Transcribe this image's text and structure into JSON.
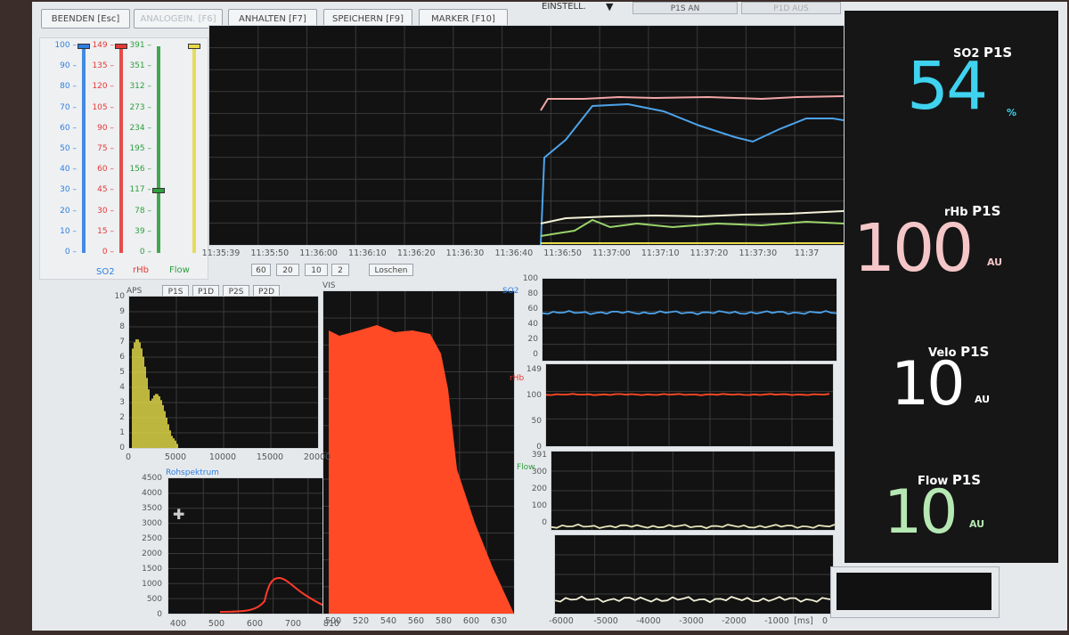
{
  "toolbar": {
    "beenden": "BEENDEN [Esc]",
    "analog": "ANALOGEIN. [F6]",
    "anhalten": "ANHALTEN [F7]",
    "speichern": "SPEICHERN [F9]",
    "marker": "MARKER [F10]",
    "einstell": "EINSTELL."
  },
  "tabs": {
    "p1s_an": "P1S AN",
    "p1d": "P1D AUS"
  },
  "sliders": {
    "so2": {
      "label": "SO2",
      "color": "#2f7fe0",
      "ticks": [
        "100",
        "90",
        "80",
        "70",
        "60",
        "50",
        "40",
        "30",
        "20",
        "10",
        "0"
      ],
      "value": 100
    },
    "rhb": {
      "label": "rHb",
      "color": "#e53935",
      "ticks": [
        "149",
        "135",
        "120",
        "105",
        "90",
        "75",
        "60",
        "45",
        "30",
        "15",
        "0"
      ],
      "value": 149
    },
    "flow": {
      "label": "Flow",
      "color": "#2e9e3e",
      "ticks": [
        "391",
        "351",
        "312",
        "273",
        "234",
        "195",
        "156",
        "117",
        "78",
        "39",
        "0"
      ],
      "value": 30
    },
    "velo": {
      "label": "",
      "color": "#e6d84a",
      "value": 100
    }
  },
  "trend": {
    "times": [
      "11:35:39",
      "11:35:50",
      "11:36:00",
      "11:36:10",
      "11:36:20",
      "11:36:30",
      "11:36:40",
      "11:36:50",
      "11:37:00",
      "11:37:10",
      "11:37:20",
      "11:37:30",
      "11:37"
    ],
    "zoom": [
      "60",
      "20",
      "10",
      "2"
    ],
    "loschen": "Loschen"
  },
  "aps": {
    "label": "APS",
    "buttons": [
      "P1S",
      "P1D",
      "P2S",
      "P2D"
    ],
    "yticks": [
      "10",
      "9",
      "8",
      "7",
      "6",
      "5",
      "4",
      "3",
      "2",
      "1",
      "0"
    ],
    "xticks": [
      "0",
      "5000",
      "10000",
      "15000",
      "20000"
    ]
  },
  "roh": {
    "label": "Rohspektrum",
    "yticks": [
      "4500",
      "4000",
      "3500",
      "3000",
      "2500",
      "2000",
      "1500",
      "1000",
      "500",
      "0"
    ],
    "xticks": [
      "400",
      "500",
      "600",
      "700",
      "810"
    ]
  },
  "vis": {
    "label": "VIS",
    "xticks": [
      "500",
      "520",
      "540",
      "560",
      "580",
      "600",
      "630"
    ]
  },
  "mini": {
    "so2": {
      "label": "SO2",
      "yticks": [
        "100",
        "80",
        "60",
        "40",
        "20",
        "0"
      ]
    },
    "rhb": {
      "label": "rHb",
      "yticks": [
        "149",
        "100",
        "50",
        "0"
      ]
    },
    "flow": {
      "label": "Flow",
      "yticks": [
        "391",
        "300",
        "200",
        "100",
        "0"
      ]
    },
    "xticks": [
      "-6000",
      "-5000",
      "-4000",
      "-3000",
      "-2000",
      "-1000",
      "[ms]",
      "0"
    ]
  },
  "values": {
    "so2": {
      "name": "SO2",
      "probe": "P1S",
      "value": "54",
      "unit": "%",
      "color": "#3fd3ef"
    },
    "rhb": {
      "name": "rHb",
      "probe": "P1S",
      "value": "100",
      "unit": "AU",
      "color": "#f4c6c8"
    },
    "velo": {
      "name": "Velo",
      "probe": "P1S",
      "value": "10",
      "unit": "AU",
      "color": "#ffffff"
    },
    "flow": {
      "name": "Flow",
      "probe": "P1S",
      "value": "10",
      "unit": "AU",
      "color": "#b6e8b4"
    }
  }
}
